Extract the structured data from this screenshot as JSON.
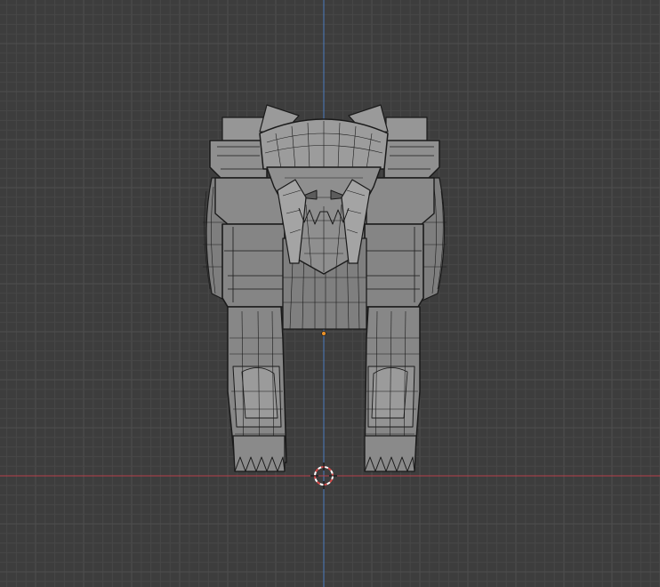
{
  "viewport": {
    "view": "front-orthographic",
    "background_color": "#3d3d3d",
    "grid": {
      "minor_color": "#474747",
      "major_color": "#4f4f4f"
    },
    "axes": {
      "x_axis_color": "#b5404a",
      "z_axis_color": "#4a7cbf"
    },
    "cursor_3d": {
      "ring_colors": [
        "#d84a4a",
        "#ffffff"
      ],
      "crosshair_color": "#111111"
    },
    "object_origin_color": "#e99028",
    "model": {
      "name": "mech-tiger",
      "solid_color": "#8b8b8b",
      "wire_color": "#1a1a1a",
      "mode": "solid-with-wireframe"
    }
  }
}
